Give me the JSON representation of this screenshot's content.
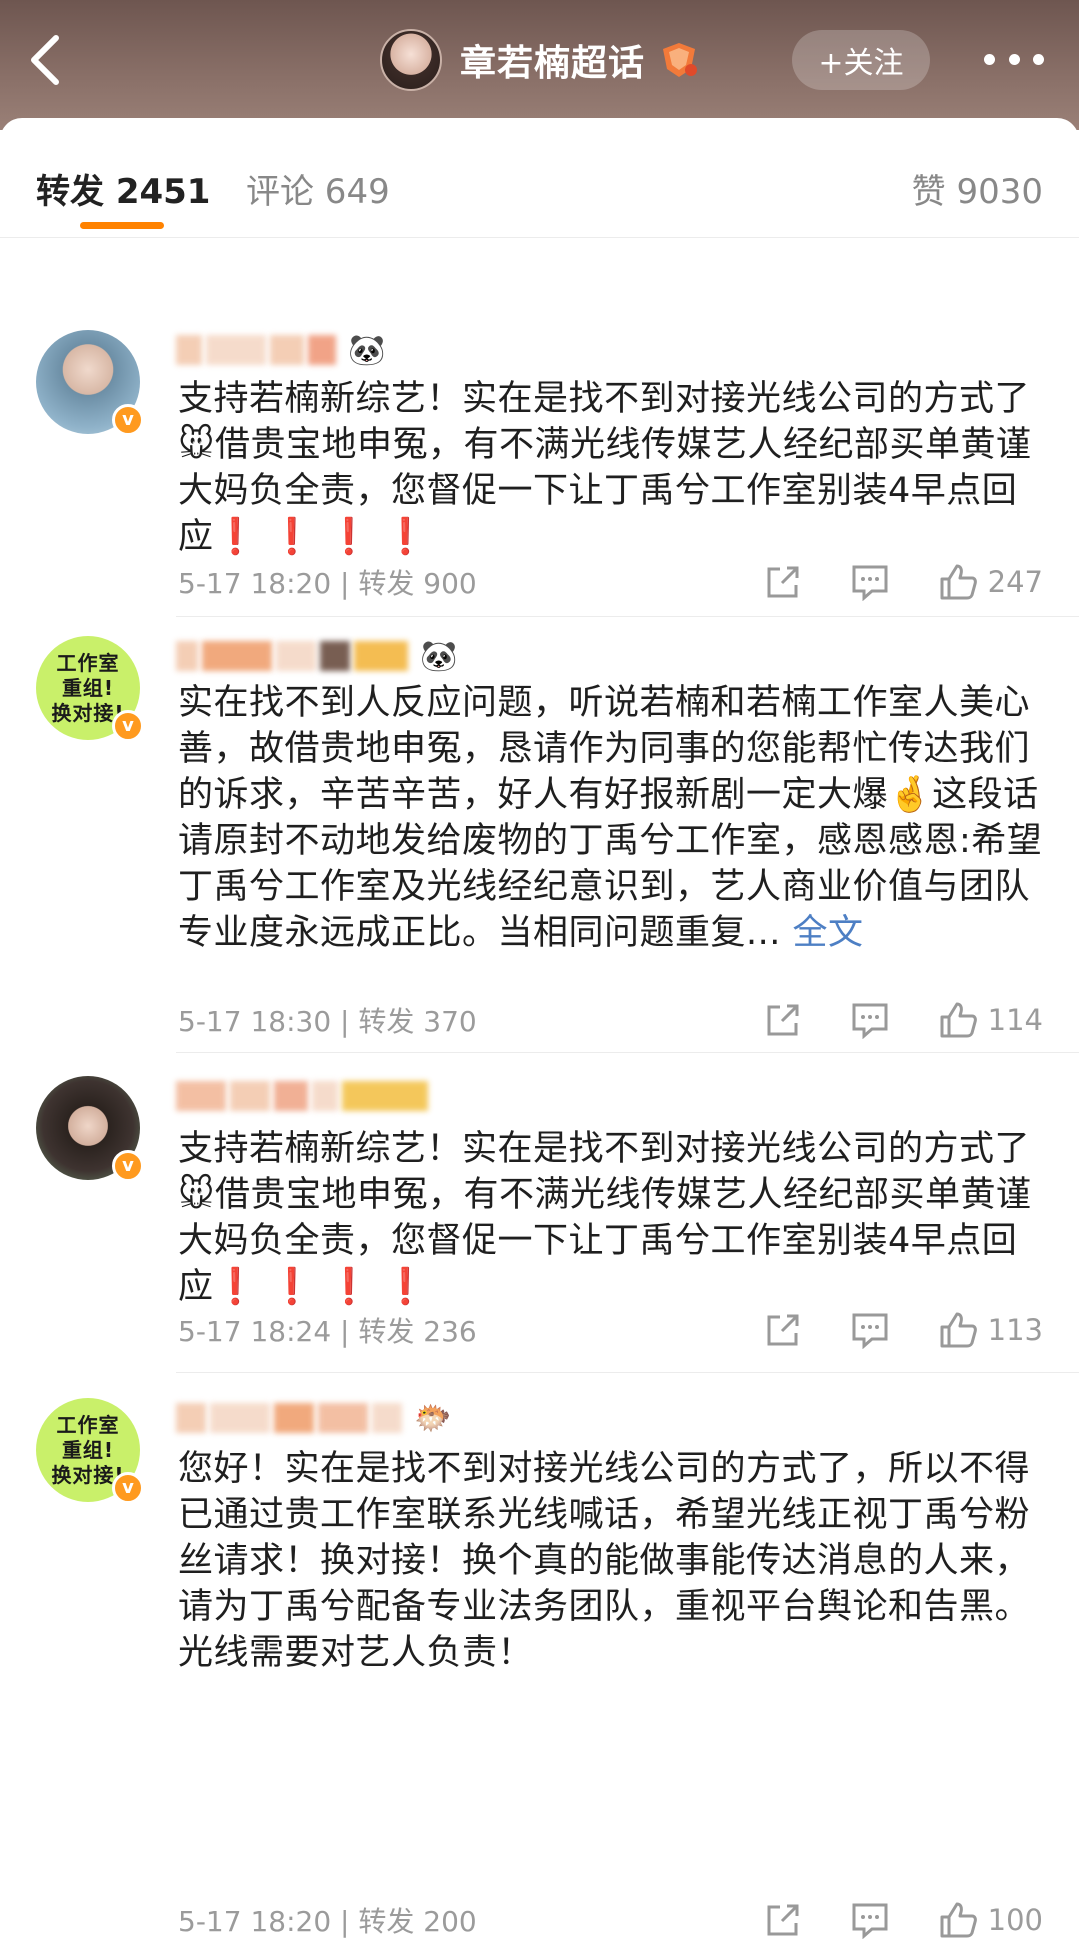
{
  "header": {
    "title": "章若楠超话",
    "follow_label": "+关注"
  },
  "tabs": {
    "forward_label": "转发 2451",
    "comment_label": "评论 649",
    "like_label": "赞 9030"
  },
  "posts": [
    {
      "body_a": "支持若楠新综艺！实在是找不到对接光线公司的方式了",
      "emoji": "🐭",
      "body_b": "借贵宝地申冤，有不满光线传媒艺人经纪部买单黄谨大妈负全责，您督促一下让丁禹兮工作室别装4早点回应",
      "marks": "❗ ❗ ❗ ❗",
      "meta": "5-17 18:20 | 转发 900",
      "like_count": "247"
    },
    {
      "body_a": "实在找不到人反应问题，听说若楠和若楠工作室人美心善，故借贵地申冤，恳请作为同事的您能帮忙传达我们的诉求，辛苦辛苦，好人有好报新剧一定大爆",
      "emoji": "🤞",
      "body_b": "这段话请原封不动地发给废物的丁禹兮工作室，感恩感恩:希望丁禹兮工作室及光线经纪意识到，艺人商业价值与团队专业度永远成正比。当相同问题重复...",
      "full_link": "全文",
      "meta": "5-17 18:30 | 转发 370",
      "like_count": "114"
    },
    {
      "body_a": "支持若楠新综艺！实在是找不到对接光线公司的方式了",
      "emoji": "🐭",
      "body_b": "借贵宝地申冤，有不满光线传媒艺人经纪部买单黄谨大妈负全责，您督促一下让丁禹兮工作室别装4早点回应",
      "marks": "❗ ❗ ❗ ❗",
      "meta": "5-17 18:24 | 转发 236",
      "like_count": "113"
    },
    {
      "body_a": "您好！实在是找不到对接光线公司的方式了，所以不得已通过贵工作室联系光线喊话，希望光线正视丁禹兮粉丝请求！换对接！换个真的能做事能传达消息的人来，请为丁禹兮配备专业法务团队，重视平台舆论和告黑。光线需要对艺人负责！",
      "meta": "5-17 18:20 | 转发 200",
      "like_count": "100"
    }
  ],
  "avatar_text": "工作室\n重组!\n换对接!",
  "colors": {
    "accent": "#ff8200",
    "link": "#4d7fc4",
    "alert_red": "#e3261b"
  },
  "icons": [
    "back-arrow-icon",
    "level-badge-icon",
    "more-icon",
    "share-icon",
    "comment-icon",
    "like-icon",
    "verified-icon"
  ]
}
